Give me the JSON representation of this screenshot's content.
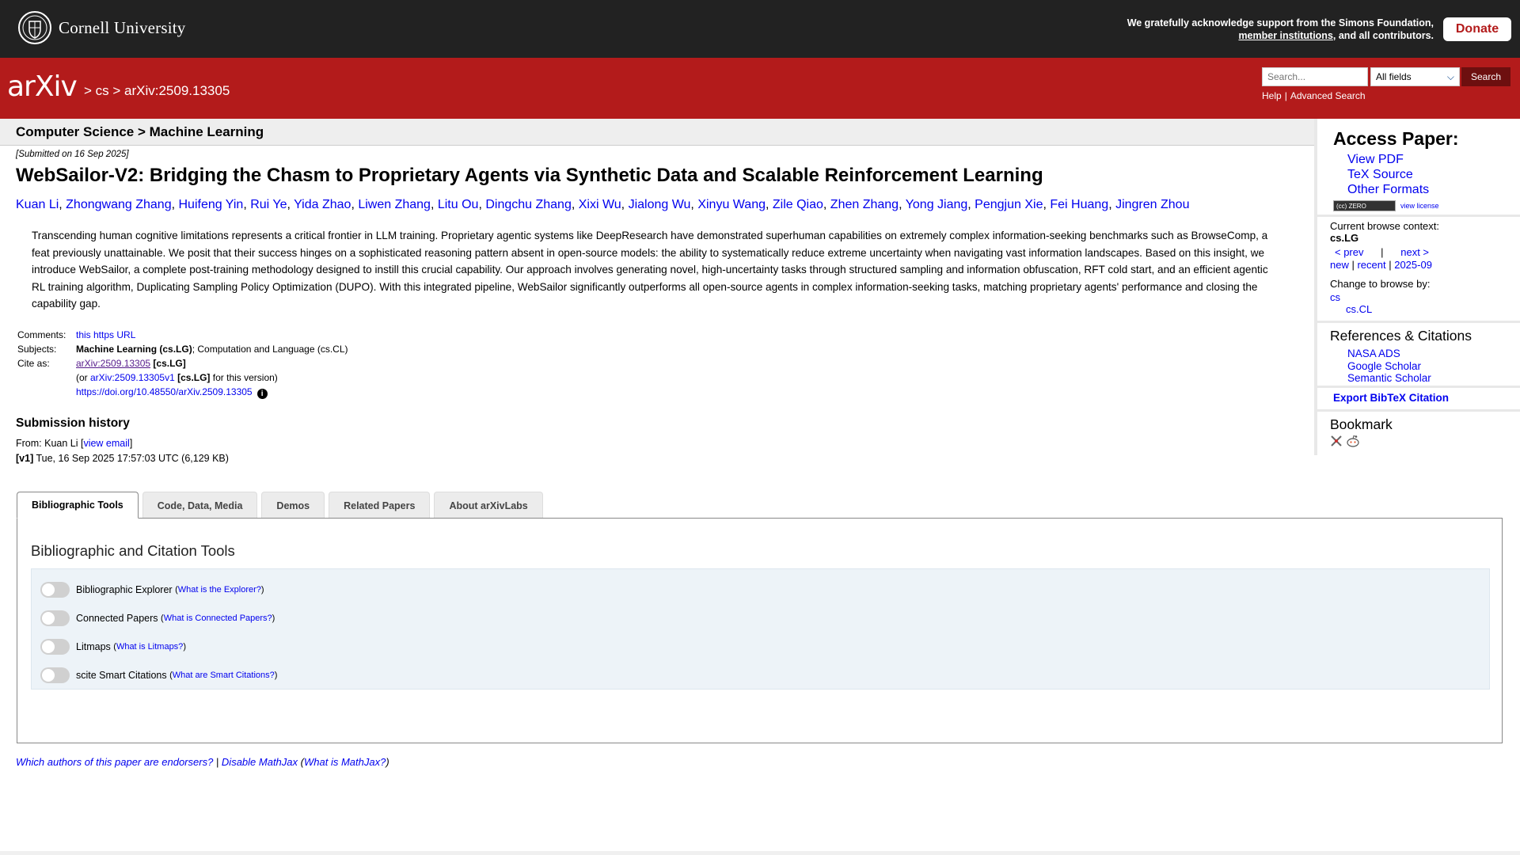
{
  "header": {
    "institution": "Cornell University",
    "ack_line1": "We gratefully acknowledge support from the Simons Foundation,",
    "ack_link": "member institutions",
    "ack_line2_rest": ", and all contributors.",
    "donate_label": "Donate"
  },
  "arxiv_bar": {
    "logo": "arXiv",
    "breadcrumb": "> cs > arXiv:2509.13305",
    "search_placeholder": "Search...",
    "search_field": "All fields",
    "search_button": "Search",
    "help_label": "Help",
    "advanced_label": "Advanced Search"
  },
  "paper": {
    "subject_bar": "Computer Science > Machine Learning",
    "submitted": "[Submitted on 16 Sep 2025]",
    "title": "WebSailor-V2: Bridging the Chasm to Proprietary Agents via Synthetic Data and Scalable Reinforcement Learning",
    "authors": [
      "Kuan Li",
      "Zhongwang Zhang",
      "Huifeng Yin",
      "Rui Ye",
      "Yida Zhao",
      "Liwen Zhang",
      "Litu Ou",
      "Dingchu Zhang",
      "Xixi Wu",
      "Jialong Wu",
      "Xinyu Wang",
      "Zile Qiao",
      "Zhen Zhang",
      "Yong Jiang",
      "Pengjun Xie",
      "Fei Huang",
      "Jingren Zhou"
    ],
    "abstract": "Transcending human cognitive limitations represents a critical frontier in LLM training. Proprietary agentic systems like DeepResearch have demonstrated superhuman capabilities on extremely complex information-seeking benchmarks such as BrowseComp, a feat previously unattainable. We posit that their success hinges on a sophisticated reasoning pattern absent in open-source models: the ability to systematically reduce extreme uncertainty when navigating vast information landscapes. Based on this insight, we introduce WebSailor, a complete post-training methodology designed to instill this crucial capability. Our approach involves generating novel, high-uncertainty tasks through structured sampling and information obfuscation, RFT cold start, and an efficient agentic RL training algorithm, Duplicating Sampling Policy Optimization (DUPO). With this integrated pipeline, WebSailor significantly outperforms all open-source agents in complex information-seeking tasks, matching proprietary agents' performance and closing the capability gap.",
    "comments_label": "Comments:",
    "comments_value": "this https URL",
    "subjects_label": "Subjects:",
    "subjects_primary": "Machine Learning (cs.LG)",
    "subjects_rest": "; Computation and Language (cs.CL)",
    "cite_label": "Cite as:",
    "cite_id": "arXiv:2509.13305",
    "cite_cat": "[cs.LG]",
    "cite_or_prefix": "(or ",
    "cite_version": "arXiv:2509.13305v1",
    "cite_version_cat": "[cs.LG]",
    "cite_version_suffix": " for this version)",
    "doi": "https://doi.org/10.48550/arXiv.2509.13305"
  },
  "history": {
    "heading": "Submission history",
    "from_prefix": "From: Kuan Li [",
    "view_email": "view email",
    "from_suffix": "]",
    "v1_label": "[v1]",
    "v1_text": " Tue, 16 Sep 2025 17:57:03 UTC (6,129 KB)"
  },
  "tabs": [
    "Bibliographic Tools",
    "Code, Data, Media",
    "Demos",
    "Related Papers",
    "About arXivLabs"
  ],
  "tools_panel": {
    "heading": "Bibliographic and Citation Tools",
    "tools": [
      {
        "name": "Bibliographic Explorer",
        "help": "What is the Explorer?",
        "enabled": false
      },
      {
        "name": "Connected Papers",
        "help": "What is Connected Papers?",
        "enabled": false
      },
      {
        "name": "Litmaps",
        "help": "What is Litmaps?",
        "enabled": false
      },
      {
        "name": "scite Smart Citations",
        "help": "What are Smart Citations?",
        "enabled": false
      }
    ]
  },
  "footer": {
    "endorsers": "Which authors of this paper are endorsers?",
    "sep": " | ",
    "mathjax": "Disable MathJax",
    "what_mathjax": "What is MathJax?"
  },
  "sidebar": {
    "access_heading": "Access Paper:",
    "access_links": [
      "View PDF",
      "TeX Source",
      "Other Formats"
    ],
    "license_badge": "ZERO",
    "view_license": "view license",
    "browse_context_label": "Current browse context:",
    "browse_context": "cs.LG",
    "prev": "< prev",
    "pipe": "|",
    "next": "next >",
    "new": "new",
    "recent": "recent",
    "month": "2025-09",
    "change_label": "Change to browse by:",
    "browse_cs": "cs",
    "browse_cscl": "cs.CL",
    "refs_heading": "References & Citations",
    "refs": [
      "NASA ADS",
      "Google Scholar",
      "Semantic Scholar"
    ],
    "export_bibtex": "Export BibTeX Citation",
    "bookmark_heading": "Bookmark"
  },
  "colors": {
    "arxiv_red": "#b31b1b",
    "top_bar": "#222222",
    "link": "#0000ee",
    "tool_bg": "#edf3f8"
  }
}
